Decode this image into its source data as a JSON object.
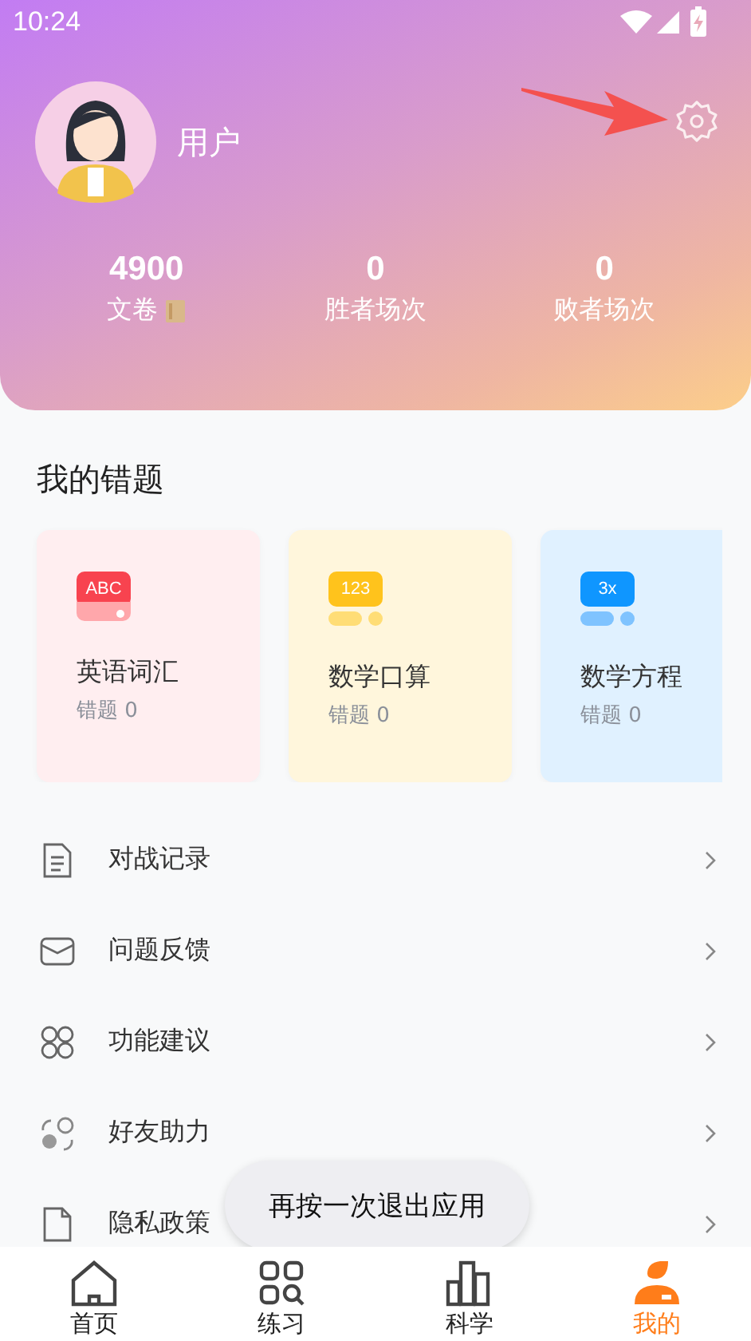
{
  "status_bar": {
    "time": "10:24"
  },
  "profile": {
    "username": "用户"
  },
  "stats": [
    {
      "value": "4900",
      "label": "文卷",
      "kind": "scroll"
    },
    {
      "value": "0",
      "label": "胜者场次",
      "kind": "plain"
    },
    {
      "value": "0",
      "label": "败者场次",
      "kind": "plain"
    }
  ],
  "mistakes": {
    "title": "我的错题",
    "cards": [
      {
        "kind": "abc",
        "icon_text": "ABC",
        "title": "英语词汇",
        "subtitle": "错题 0"
      },
      {
        "kind": "num",
        "icon_text": "123",
        "title": "数学口算",
        "subtitle": "错题 0"
      },
      {
        "kind": "eq",
        "icon_text": "3x",
        "title": "数学方程",
        "subtitle": "错题 0"
      }
    ]
  },
  "menu": [
    {
      "kind": "doc",
      "label": "对战记录"
    },
    {
      "kind": "mail",
      "label": "问题反馈"
    },
    {
      "kind": "grid",
      "label": "功能建议"
    },
    {
      "kind": "friends",
      "label": "好友助力"
    },
    {
      "kind": "page",
      "label": "隐私政策"
    }
  ],
  "toast": "再按一次退出应用",
  "tabs": [
    {
      "kind": "home",
      "label": "首页",
      "selected": false
    },
    {
      "kind": "practice",
      "label": "练习",
      "selected": false
    },
    {
      "kind": "science",
      "label": "科学",
      "selected": false
    },
    {
      "kind": "me",
      "label": "我的",
      "selected": true
    }
  ]
}
